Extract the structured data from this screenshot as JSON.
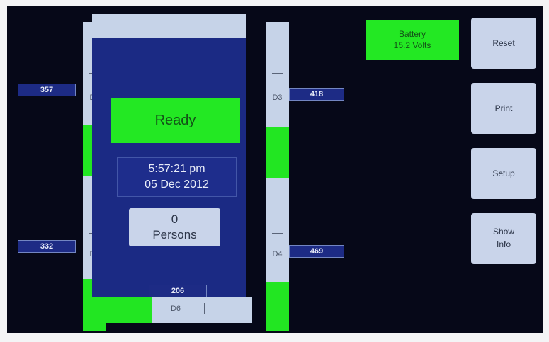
{
  "status": {
    "label": "Ready"
  },
  "clock": {
    "time": "5:57:21 pm",
    "date": "05 Dec 2012"
  },
  "persons": {
    "count": "0",
    "label": "Persons"
  },
  "battery": {
    "line1": "Battery",
    "line2": "15.2 Volts"
  },
  "buttons": {
    "reset": "Reset",
    "print": "Print",
    "setup": "Setup",
    "show_info_1": "Show",
    "show_info_2": "Info"
  },
  "detectors": {
    "d1": {
      "label": "D1",
      "value": "357"
    },
    "d2": {
      "label": "D2",
      "value": "332"
    },
    "d3": {
      "label": "D3",
      "value": "418"
    },
    "d4": {
      "label": "D4",
      "value": "469"
    },
    "d6": {
      "label": "D6",
      "value": "206"
    }
  },
  "colors": {
    "background": "#1a2a86",
    "status_green": "#23e823",
    "panel_light": "#c9d4ea",
    "text_dark": "#2c3548"
  }
}
